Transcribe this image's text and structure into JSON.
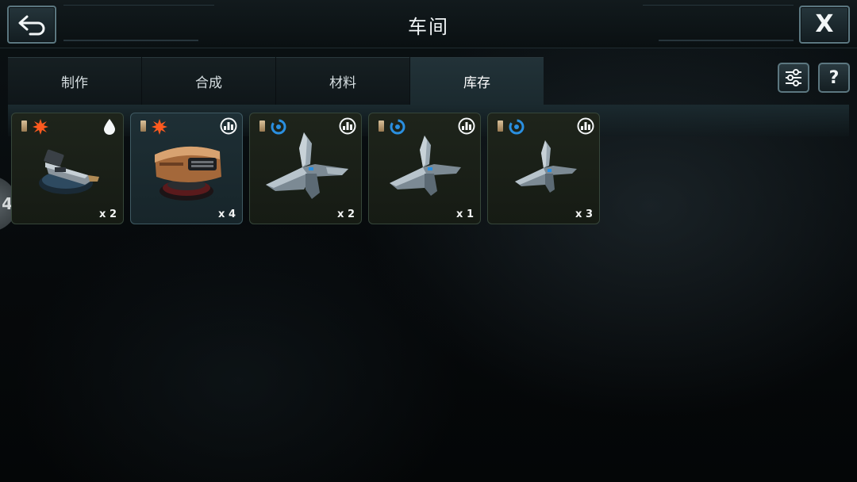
{
  "header": {
    "title": "车间",
    "back_icon": "back-arrow-icon",
    "close_label": "X"
  },
  "tabs": [
    {
      "label": "制作",
      "active": false
    },
    {
      "label": "合成",
      "active": false
    },
    {
      "label": "材料",
      "active": false
    },
    {
      "label": "库存",
      "active": true
    }
  ],
  "toolbar": {
    "filter_icon": "sliders-icon",
    "help_label": "?"
  },
  "side_handle": {
    "label": "4"
  },
  "inventory": [
    {
      "name": "turret-cannon",
      "faction_icon": "orange-burst-icon",
      "type_icon": "droplet-icon",
      "quantity": "x 2",
      "selected": false
    },
    {
      "name": "armored-pod",
      "faction_icon": "orange-burst-icon",
      "type_icon": "tower-icon",
      "quantity": "x 4",
      "selected": true
    },
    {
      "name": "fighter-ship",
      "faction_icon": "blue-swirl-icon",
      "type_icon": "tower-icon",
      "quantity": "x 2",
      "selected": false
    },
    {
      "name": "fighter-ship",
      "faction_icon": "blue-swirl-icon",
      "type_icon": "tower-icon",
      "quantity": "x 1",
      "selected": false
    },
    {
      "name": "fighter-ship",
      "faction_icon": "blue-swirl-icon",
      "type_icon": "tower-icon",
      "quantity": "x 3",
      "selected": false
    }
  ],
  "colors": {
    "accent_orange": "#ff5a1f",
    "accent_blue": "#2a8fe0",
    "tab_active": "#1f2f35",
    "card_bg": "#1b2118"
  }
}
